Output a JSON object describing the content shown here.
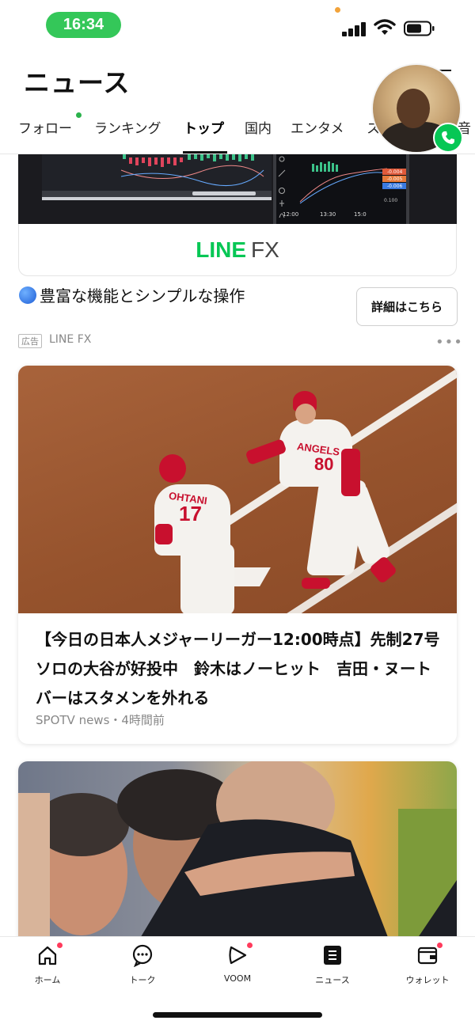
{
  "status_bar": {
    "time": "16:34"
  },
  "header": {
    "title": "ニュース"
  },
  "tabs": [
    {
      "label": "フォロー"
    },
    {
      "label": "ランキング"
    },
    {
      "label": "トップ"
    },
    {
      "label": "国内"
    },
    {
      "label": "エンタメ"
    },
    {
      "label": "ス"
    },
    {
      "label": "音"
    }
  ],
  "ad": {
    "logo_line": "LINE",
    "logo_fx": "FX",
    "headline": "豊富な機能とシンプルな操作",
    "cta": "詳細はこちら",
    "badge": "広告",
    "sponsor": "LINE FX",
    "chart_times": [
      "12:00",
      "13:30",
      "15:0",
      "0.100"
    ],
    "price_values": [
      "-0.004",
      "-0.005",
      "-0.006"
    ]
  },
  "articles": [
    {
      "title": "【今日の日本人メジャーリーガー12:00時点】先制27号ソロの大谷が好投中　鈴木はノーヒット　吉田・ヌートバーはスタメンを外れる",
      "source": "SPOTV news・4時間前",
      "jersey_left_name": "OHTANI",
      "jersey_left_number": "17",
      "jersey_right_name": "ANGELS",
      "jersey_right_number": "80"
    }
  ],
  "tabbar": [
    {
      "label": "ホーム",
      "icon": "home-icon",
      "badge": true
    },
    {
      "label": "トーク",
      "icon": "chat-icon",
      "badge": false
    },
    {
      "label": "VOOM",
      "icon": "voom-icon",
      "badge": true
    },
    {
      "label": "ニュース",
      "icon": "news-icon",
      "badge": false
    },
    {
      "label": "ウォレット",
      "icon": "wallet-icon",
      "badge": true
    }
  ],
  "colors": {
    "line_green": "#06c755",
    "status_green": "#34c759",
    "badge_red": "#ff3b5c",
    "angels_red": "#c8102e"
  }
}
